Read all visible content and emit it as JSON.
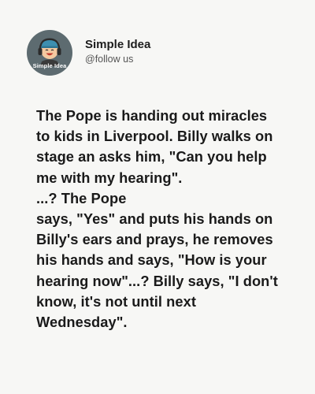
{
  "profile": {
    "avatar_label": "Simple Idea",
    "name": "Simple Idea",
    "handle": "@follow us"
  },
  "post": {
    "text": "The Pope is handing out miracles\nto kids in Liverpool. Billy walks on\nstage an asks him, \"Can you help\nme with my hearing\".\n...? The Pope\nsays, \"Yes\" and puts his hands on\nBilly's ears and prays, he removes\nhis hands and says, \"How is your\nhearing now\"...? Billy says, \"I don't\nknow, it's not until next\nWednesday\"."
  },
  "colors": {
    "background": "#f7f7f5",
    "avatar_bg": "#5d6b70",
    "text": "#1a1a1a"
  }
}
